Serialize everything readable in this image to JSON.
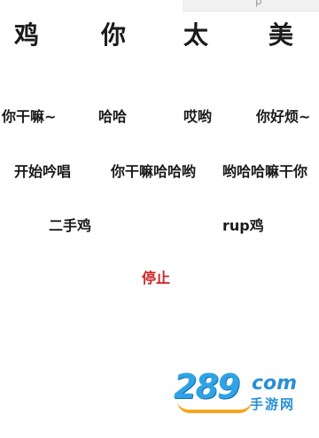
{
  "status_bar": {
    "glyph": "ρ"
  },
  "title_chars": [
    "鸡",
    "你",
    "太",
    "美"
  ],
  "sound_buttons": [
    {
      "label": "你干嘛~"
    },
    {
      "label": "哈哈"
    },
    {
      "label": "哎哟"
    },
    {
      "label": "你好烦~"
    },
    {
      "label": "开始吟唱"
    },
    {
      "label": "你干嘛哈哈哟"
    },
    {
      "label": "哟哈哈嘛干你"
    },
    {
      "label": "二手鸡"
    },
    {
      "label": "rup鸡"
    }
  ],
  "stop_button": {
    "label": "停止",
    "color": "#cc2222"
  },
  "watermark": {
    "number": "289",
    "suffix": "com",
    "subtitle": "手游网"
  }
}
